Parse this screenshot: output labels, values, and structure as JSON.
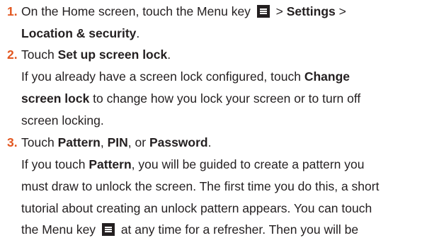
{
  "steps": [
    {
      "number": "1.",
      "t1": "On the Home screen, touch the Menu key",
      "t2": " > ",
      "settings": "Settings",
      "t3": " >",
      "location_security": "Location & security",
      "t4": "."
    },
    {
      "number": "2.",
      "t1": "Touch ",
      "set_up_screen_lock": "Set up screen lock",
      "t2": ".",
      "note_a": "If you already have a screen lock configured, touch ",
      "change_1": "Change",
      "change_2": "screen lock",
      "note_b": " to change how you lock your screen or to turn off",
      "note_c": "screen locking."
    },
    {
      "number": "3.",
      "t1": "Touch ",
      "pattern": "Pattern",
      "t2": ", ",
      "pin": "PIN",
      "t3": ", or ",
      "password": "Password",
      "t4": ".",
      "p1a": "If you touch ",
      "p1_pattern": "Pattern",
      "p1b": ", you will be guided to create a pattern you",
      "p2": "must draw to unlock the screen. The first time you do this, a short",
      "p3": "tutorial about creating an unlock pattern appears. You can touch",
      "p4a": "the Menu key",
      "p4b": "at any time for a refresher. Then you will be"
    }
  ],
  "icons": {
    "menu_key": "menu-key-icon"
  },
  "colors": {
    "step_number": "#e2561f",
    "text": "#231f20"
  }
}
